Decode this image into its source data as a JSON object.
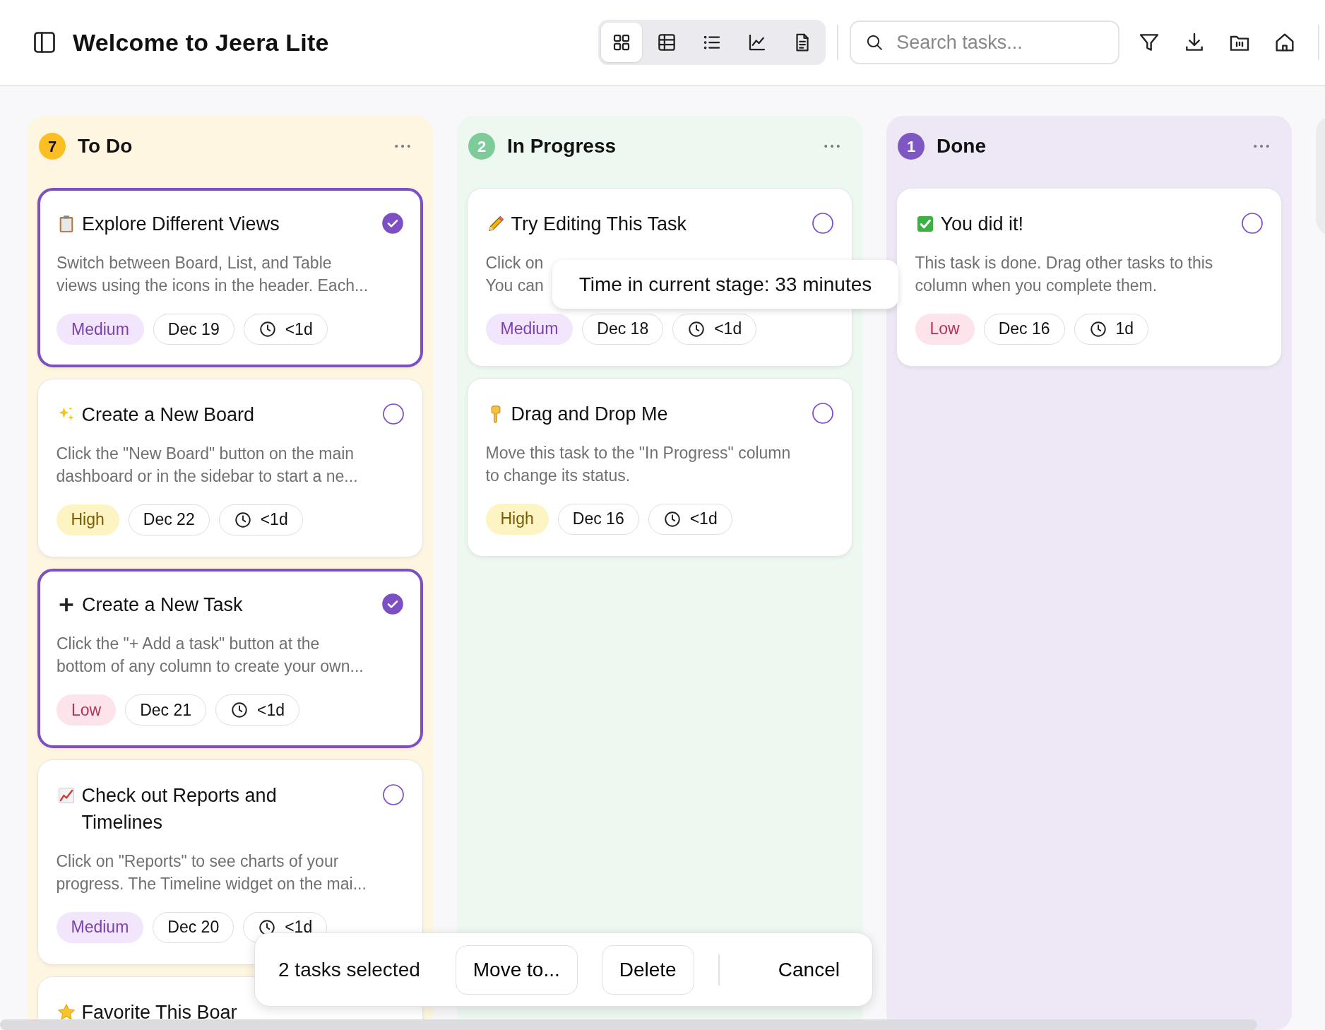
{
  "header": {
    "title": "Welcome to Jeera Lite",
    "views": [
      {
        "selected": true
      },
      {
        "selected": false
      },
      {
        "selected": false
      },
      {
        "selected": false
      },
      {
        "selected": false
      }
    ],
    "search": {
      "placeholder": "Search tasks..."
    }
  },
  "columns": [
    {
      "title": "To Do",
      "count": "7",
      "color": "#fbbf24",
      "cards": [
        {
          "title": [
            "Explore Different Views"
          ],
          "description": [
            "Switch between Board, List, and Table",
            "views using the icons in the header. Each..."
          ],
          "priority": {
            "label": "Medium",
            "kind": "medium"
          },
          "due": "Dec 19",
          "age": "<1d",
          "selected": true
        },
        {
          "title": [
            "Create a New Board"
          ],
          "description": [
            "Click the \"New Board\" button on the main",
            "dashboard or in the sidebar to start a ne..."
          ],
          "priority": {
            "label": "High",
            "kind": "high"
          },
          "due": "Dec 22",
          "age": "<1d",
          "selected": false
        },
        {
          "title": [
            "Create a New Task"
          ],
          "description": [
            "Click the \"+ Add a task\" button at the",
            "bottom of any column to create your own..."
          ],
          "priority": {
            "label": "Low",
            "kind": "low"
          },
          "due": "Dec 21",
          "age": "<1d",
          "selected": true
        },
        {
          "title": [
            "Check out Reports and",
            "Timelines"
          ],
          "description": [
            "Click on \"Reports\" to see charts of your",
            "progress. The Timeline widget on the mai..."
          ],
          "priority": {
            "label": "Medium",
            "kind": "medium"
          },
          "due": "Dec 20",
          "age": "<1d",
          "selected": false
        },
        {
          "title": [
            "Favorite This Boar"
          ]
        }
      ]
    },
    {
      "title": "In Progress",
      "count": "2",
      "color": "#7ccb98",
      "cards": [
        {
          "title": [
            "Try Editing This Task"
          ],
          "description": [
            "Click on",
            "You can"
          ],
          "priority": {
            "label": "Medium",
            "kind": "medium"
          },
          "due": "Dec 18",
          "age": "<1d",
          "selected": false
        },
        {
          "title": [
            "Drag and Drop Me"
          ],
          "description": [
            "Move this task to the \"In Progress\" column",
            "to change its status."
          ],
          "priority": {
            "label": "High",
            "kind": "high"
          },
          "due": "Dec 16",
          "age": "<1d",
          "selected": false
        }
      ]
    },
    {
      "title": "Done",
      "count": "1",
      "color": "#7e57c2",
      "cards": [
        {
          "title": [
            "You did it!"
          ],
          "description": [
            "This task is done. Drag other tasks to this",
            "column when you complete them."
          ],
          "priority": {
            "label": "Low",
            "kind": "low"
          },
          "due": "Dec 16",
          "age": "1d",
          "selected": false
        }
      ]
    }
  ],
  "tooltip": {
    "text": "Time in current stage: 33 minutes"
  },
  "selection_bar": {
    "label": "2 tasks selected",
    "buttons": [
      {
        "label": "Move to...",
        "kind": "outline"
      },
      {
        "label": "Delete",
        "kind": "outline"
      },
      {
        "label": "Cancel",
        "kind": "plain"
      }
    ]
  }
}
